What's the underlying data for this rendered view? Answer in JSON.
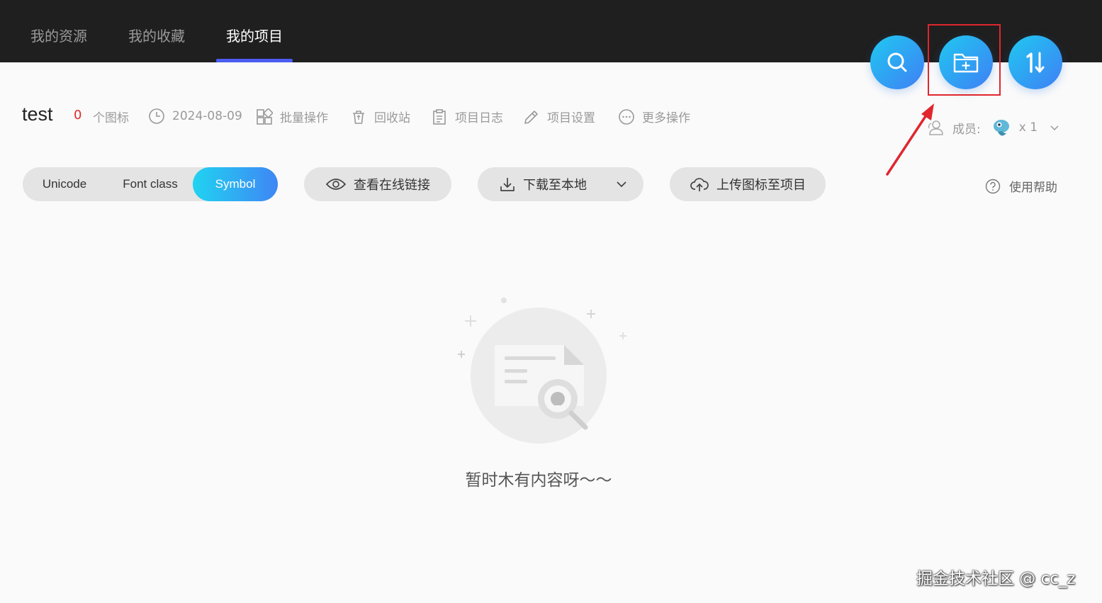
{
  "nav": {
    "tabs": [
      {
        "label": "我的资源"
      },
      {
        "label": "我的收藏"
      },
      {
        "label": "我的项目"
      }
    ],
    "active_tab": "我的项目"
  },
  "fab": {
    "search_icon": "search-icon",
    "new_project_icon": "folder-plus-icon",
    "sort_icon": "sort-icon",
    "sort_label": "1↓"
  },
  "project": {
    "name": "test",
    "icon_count": "0",
    "icon_count_unit": "个图标",
    "date": "2024-08-09",
    "actions": {
      "batch": "批量操作",
      "recycle": "回收站",
      "log": "项目日志",
      "settings": "项目设置",
      "more": "更多操作"
    }
  },
  "members": {
    "label": "成员:",
    "count": "x 1"
  },
  "toolbar": {
    "formats": [
      "Unicode",
      "Font class",
      "Symbol"
    ],
    "active_format": "Symbol",
    "view_link": "查看在线链接",
    "download": "下载至本地",
    "upload": "上传图标至项目",
    "help": "使用帮助"
  },
  "empty": {
    "message": "暂时木有内容呀～～"
  },
  "watermark": "掘金技术社区 @ cc_z",
  "colors": {
    "topbar": "#1f1f1f",
    "accent": "#4b5cf0",
    "gradient_start": "#1fc9f0",
    "gradient_end": "#3f7ff5",
    "count_red": "#e02a2a",
    "highlight": "#e0262e"
  }
}
